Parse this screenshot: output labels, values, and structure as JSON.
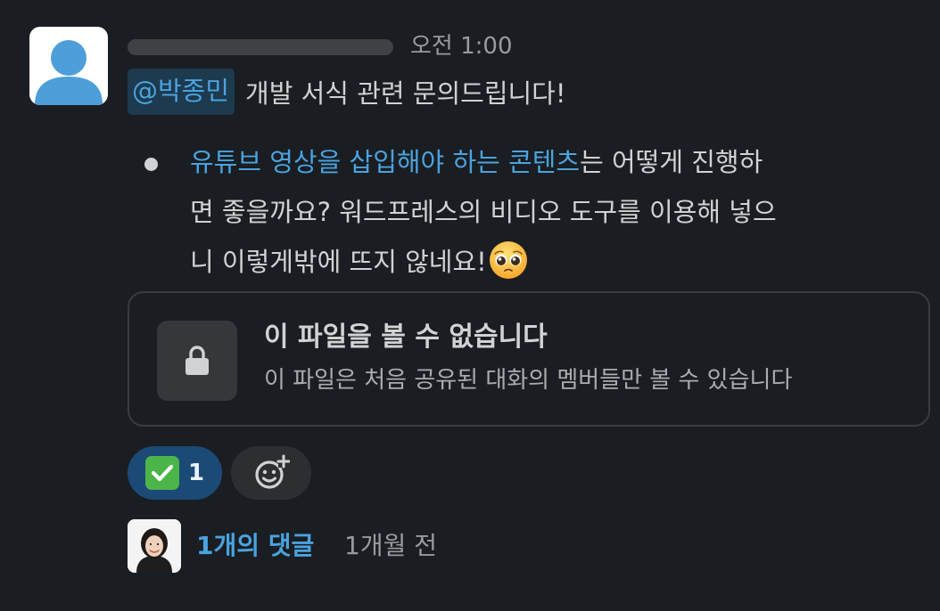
{
  "message": {
    "timestamp": "오전 1:00",
    "mention": "@박종민",
    "text": "개발 서식 관련 문의드립니다!",
    "bullet": {
      "link_text": "유튜브 영상을 삽입해야 하는 콘텐츠",
      "line1_rest": "는 어떻게 진행하",
      "line2": "면 좋을까요? 워드프레스의 비디오 도구를 이용해 넣으",
      "line3": "니 이렇게밖에 뜨지 않네요!",
      "emoji": "pleading-face-icon"
    }
  },
  "file_card": {
    "title": "이 파일을 볼 수 없습니다",
    "subtitle": "이 파일은 처음 공유된 대화의 멤버들만 볼 수 있습니다",
    "icon": "lock-icon"
  },
  "reactions": [
    {
      "emoji": "check-mark-button-icon",
      "count": "1"
    }
  ],
  "add_reaction_icon": "add-emoji-icon",
  "thread": {
    "reply_count": "1개의 댓글",
    "last_reply": "1개월 전"
  },
  "colors": {
    "background": "#1a1d21",
    "link": "#4aa3df",
    "mention_bg": "#1d3a4e",
    "reaction_bg": "#1c4a76",
    "avatar_blue": "#4d9ed9"
  }
}
